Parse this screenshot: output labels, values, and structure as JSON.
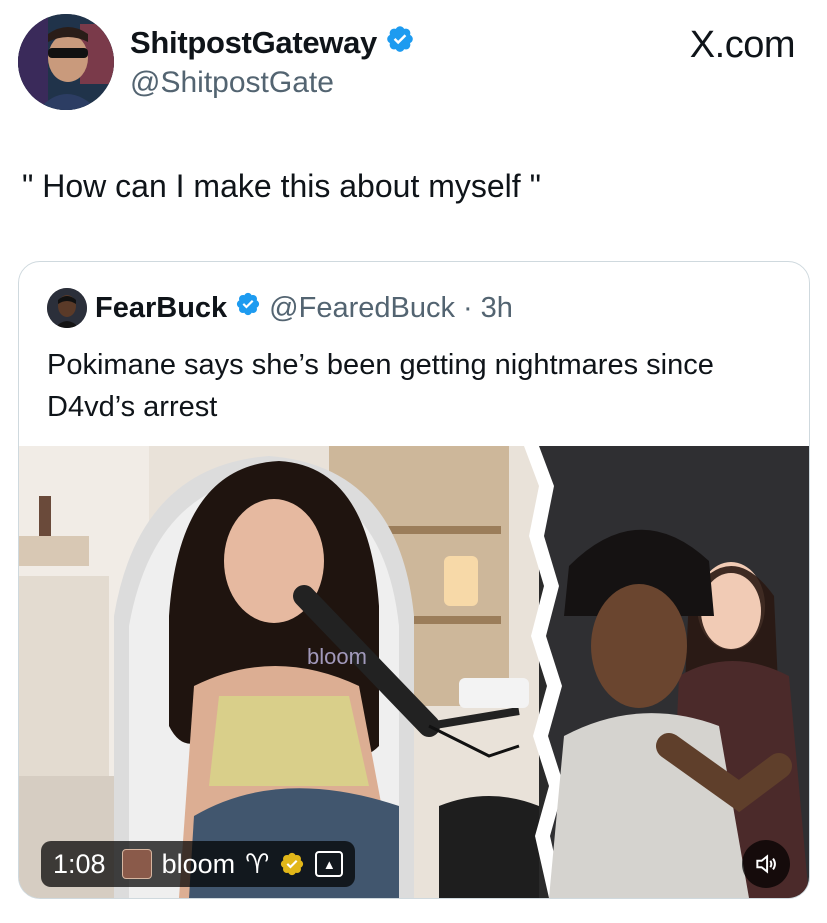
{
  "post": {
    "author_name": "ShitpostGateway",
    "author_handle": "@ShitpostGate",
    "site_logo": "X.com",
    "text": "\" How can I make this about myself \""
  },
  "quoted": {
    "author_name": "FearBuck",
    "author_handle": "@FearedBuck",
    "separator": "·",
    "time_ago": "3h",
    "text": "Pokimane says she’s been getting nightmares since D4vd’s arrest",
    "media": {
      "duration": "1:08",
      "source_name": "bloom",
      "source_suffix": "♈",
      "watermark": "bloom"
    }
  },
  "colors": {
    "verified_blue": "#1d9bf0",
    "text_primary": "#0f1419",
    "text_secondary": "#536471",
    "border": "#cfd9de"
  },
  "icons": [
    "verified-badge-icon",
    "sound-icon",
    "gold-badge-icon",
    "ai-label-icon"
  ]
}
